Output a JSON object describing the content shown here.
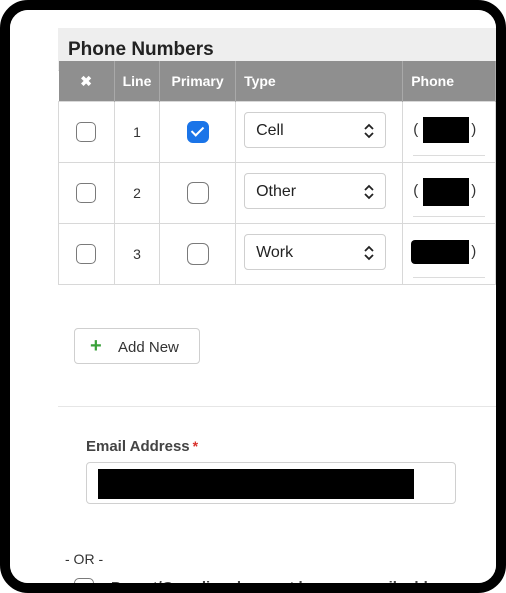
{
  "panel": {
    "title": "Phone Numbers"
  },
  "table": {
    "headers": {
      "delete": "✖",
      "line": "Line",
      "primary": "Primary",
      "type": "Type",
      "phone": "Phone"
    },
    "rows": [
      {
        "line": "1",
        "primary": true,
        "type": "Cell"
      },
      {
        "line": "2",
        "primary": false,
        "type": "Other"
      },
      {
        "line": "3",
        "primary": false,
        "type": "Work"
      }
    ],
    "phone_open_paren": "(",
    "phone_close_paren": ")"
  },
  "add_button": {
    "label": "Add New",
    "icon": "plus-icon",
    "icon_color": "#3aa13a"
  },
  "email": {
    "label": "Email Address",
    "required_mark": "*"
  },
  "or_separator": "- OR -",
  "guardian_checkbox": {
    "label": "Parent/Guardian does not have an email address"
  },
  "colors": {
    "header_bg": "#8f8f8f",
    "checked_blue": "#1a74e8",
    "required_red": "#d9302b"
  }
}
